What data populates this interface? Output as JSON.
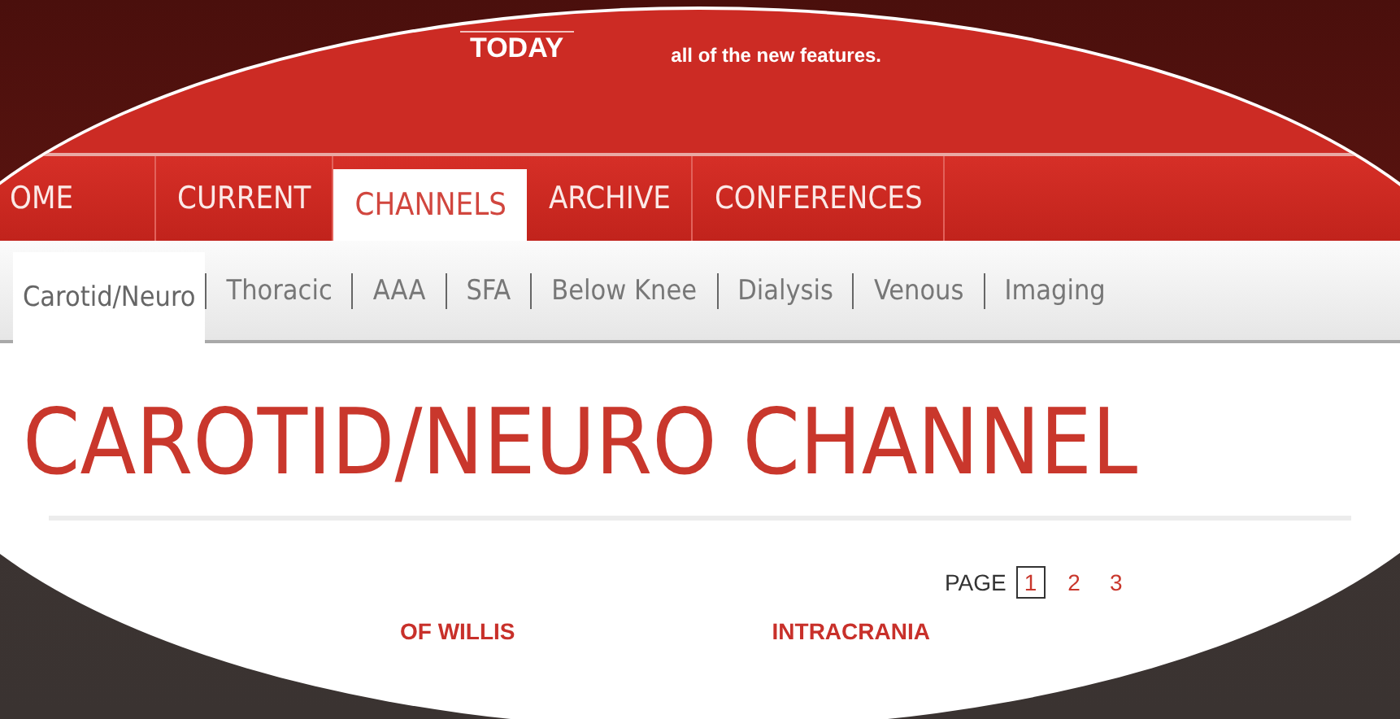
{
  "header": {
    "logo": "TODAY",
    "promo": "all of the new features."
  },
  "nav": [
    {
      "label": "OME",
      "selected": false
    },
    {
      "label": "CURRENT",
      "selected": false
    },
    {
      "label": "CHANNELS",
      "selected": true
    },
    {
      "label": "ARCHIVE",
      "selected": false
    },
    {
      "label": "CONFERENCES",
      "selected": false
    }
  ],
  "subnav": [
    {
      "label": "Carotid/Neuro",
      "selected": true
    },
    {
      "label": "Thoracic",
      "selected": false
    },
    {
      "label": "AAA",
      "selected": false
    },
    {
      "label": "SFA",
      "selected": false
    },
    {
      "label": "Below Knee",
      "selected": false
    },
    {
      "label": "Dialysis",
      "selected": false
    },
    {
      "label": "Venous",
      "selected": false
    },
    {
      "label": "Imaging",
      "selected": false
    }
  ],
  "heading": "CAROTID/NEURO CHANNEL",
  "pagination": {
    "label": "PAGE",
    "pages": [
      {
        "label": "1",
        "selected": true
      },
      {
        "label": "2",
        "selected": false
      },
      {
        "label": "3",
        "selected": false
      }
    ]
  },
  "articles": [
    "OF WILLIS",
    "INTRACRANIA"
  ]
}
